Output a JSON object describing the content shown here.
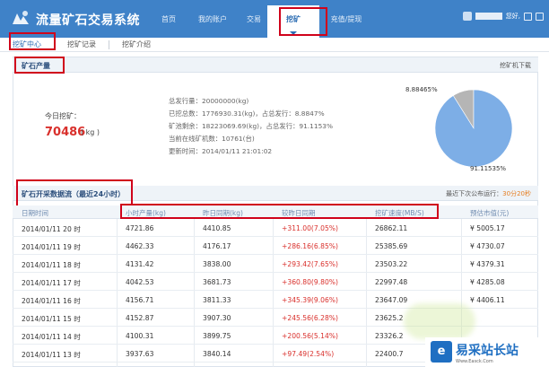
{
  "header": {
    "app_title": "流量矿石交易系统",
    "nav": [
      {
        "label": "首页"
      },
      {
        "label": "我的账户"
      },
      {
        "label": "交易"
      },
      {
        "label": "挖矿"
      },
      {
        "label": "充值/提现"
      }
    ],
    "user_greeting": "您好,"
  },
  "subnav": {
    "items": [
      {
        "label": "挖矿中心"
      },
      {
        "label": "挖矿记录"
      },
      {
        "label": "挖矿介绍"
      }
    ]
  },
  "output_section": {
    "title": "矿石产量",
    "right_link": "挖矿机下载",
    "today_label": "今日挖矿：",
    "today_value": "70486",
    "today_unit": "( kg )",
    "stats": [
      "总发行量：20000000(kg)",
      "已挖总数：1776930.31(kg)，占总发行：8.8847%",
      "矿池剩余：18223069.69(kg)，占总发行：91.1153%",
      "当前在线矿机数：10761(台)",
      "更新时间：2014/01/11 21:01:02"
    ]
  },
  "chart_data": {
    "type": "pie",
    "slices": [
      {
        "label": "8.88465%",
        "value": 8.88465
      },
      {
        "label": "91.11535%",
        "value": 91.11535
      }
    ],
    "colors": [
      "#b5b5b5",
      "#7daee6"
    ]
  },
  "data_section": {
    "title": "矿石开采数据流（最近24小时）",
    "right_text": "最近下次公布运行：",
    "right_value": "30分20秒",
    "columns": [
      "日期时间",
      "小时产量(kg)",
      "昨日同期(kg)",
      "较昨日同期",
      "挖矿速度(MB/S)",
      "预估市值(元)"
    ],
    "rows": [
      [
        "2014/01/11 20 时",
        "4721.86",
        "4410.85",
        "+311.00(7.05%)",
        "26862.11",
        "¥ 5005.17"
      ],
      [
        "2014/01/11 19 时",
        "4462.33",
        "4176.17",
        "+286.16(6.85%)",
        "25385.69",
        "¥ 4730.07"
      ],
      [
        "2014/01/11 18 时",
        "4131.42",
        "3838.00",
        "+293.42(7.65%)",
        "23503.22",
        "¥ 4379.31"
      ],
      [
        "2014/01/11 17 时",
        "4042.53",
        "3681.73",
        "+360.80(9.80%)",
        "22997.48",
        "¥ 4285.08"
      ],
      [
        "2014/01/11 16 时",
        "4156.71",
        "3811.33",
        "+345.39(9.06%)",
        "23647.09",
        "¥ 4406.11"
      ],
      [
        "2014/01/11 15 时",
        "4152.87",
        "3907.30",
        "+245.56(6.28%)",
        "23625.2",
        ""
      ],
      [
        "2014/01/11 14 时",
        "4100.31",
        "3899.75",
        "+200.56(5.14%)",
        "23326.2",
        ""
      ],
      [
        "2014/01/11 13 时",
        "3937.63",
        "3840.14",
        "+97.49(2.54%)",
        "22400.7",
        ""
      ]
    ]
  },
  "watermark": {
    "logo_char": "e",
    "text": "易采站长站",
    "sub": "Www.Easck.Com"
  }
}
